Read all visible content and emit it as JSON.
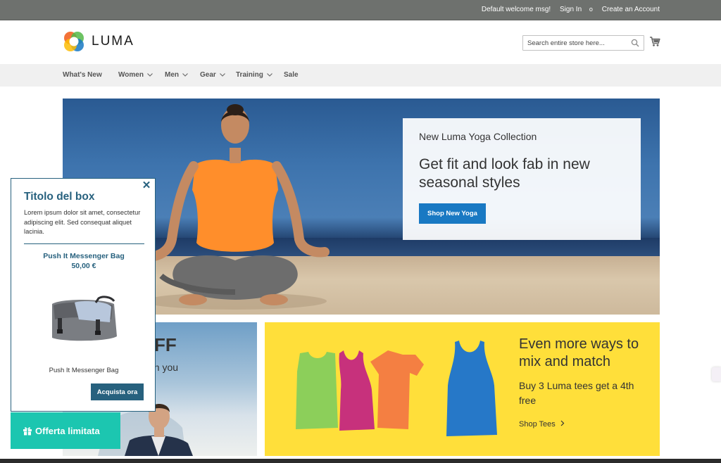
{
  "topbar": {
    "welcome": "Default welcome msg!",
    "sign_in": "Sign In",
    "separator": "o",
    "create_account": "Create an Account"
  },
  "header": {
    "logo_text": "LUMA",
    "search": {
      "placeholder": "Search entire store here..."
    },
    "icons": [
      "luma-logo-icon",
      "search-icon",
      "cart-icon"
    ]
  },
  "nav": {
    "items": [
      {
        "label": "What's New",
        "has_dropdown": false
      },
      {
        "label": "Women",
        "has_dropdown": true
      },
      {
        "label": "Men",
        "has_dropdown": true
      },
      {
        "label": "Gear",
        "has_dropdown": true
      },
      {
        "label": "Training",
        "has_dropdown": true
      },
      {
        "label": "Sale",
        "has_dropdown": false
      }
    ]
  },
  "hero": {
    "subtitle": "New Luma Yoga Collection",
    "title": "Get fit and look fab in new seasonal styles",
    "button": "Shop New Yoga"
  },
  "promo_left": {
    "title_fragment": "FF",
    "subtitle_fragment": "en you"
  },
  "promo_right": {
    "title": "Even more ways to mix and match",
    "text": "Buy 3 Luma tees get a 4th free",
    "link": "Shop Tees"
  },
  "popup": {
    "title": "Titolo del box",
    "description": "Lorem ipsum dolor sit amet, consectetur adipiscing elit. Sed consequat aliquet lacinia.",
    "product_name": "Push It Messenger Bag",
    "price": "50,00 €",
    "product_caption": "Push It Messenger Bag",
    "buy_button": "Acquista ora",
    "close_icon": "close-icon"
  },
  "offer_button": {
    "label": "Offerta limitata",
    "icon": "gift-icon"
  },
  "colors": {
    "topbar": "#6e716e",
    "nav_bg": "#f0f0f0",
    "primary_blue": "#1979c3",
    "popup_accent": "#27617e",
    "offer_teal": "#1cc6b0",
    "promo_yellow": "#ffdf3a"
  }
}
